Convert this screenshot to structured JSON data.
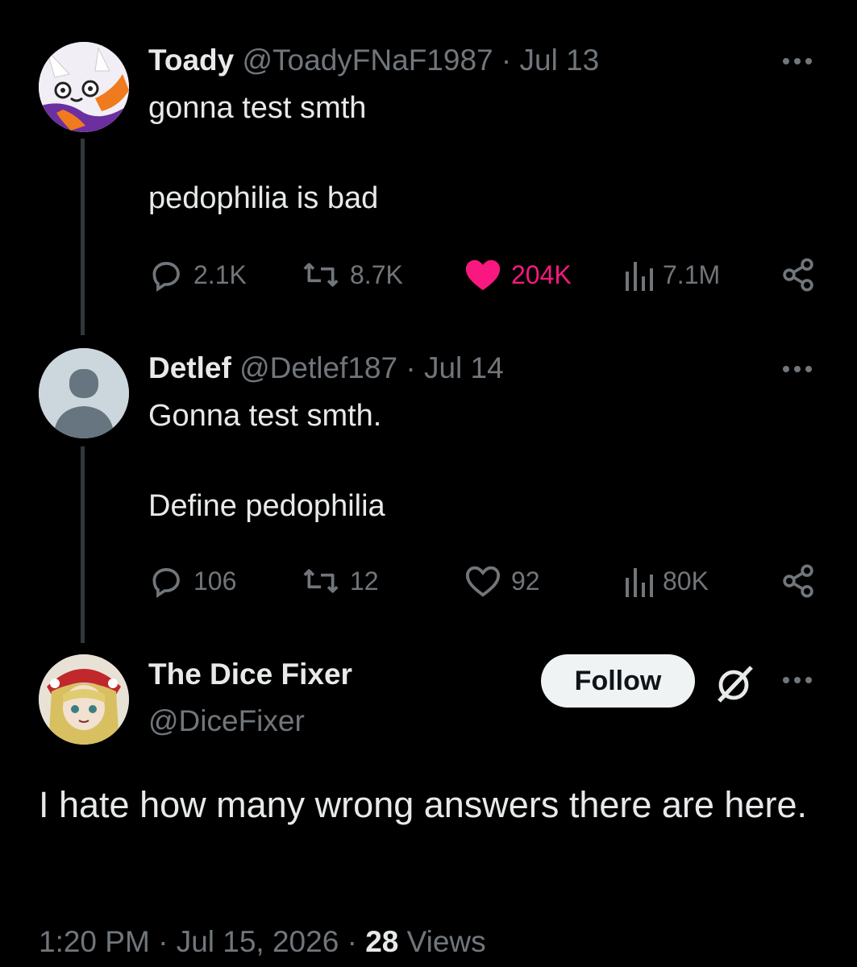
{
  "tweets": [
    {
      "name": "Toady",
      "handle": "@ToadyFNaF1987",
      "separator": "·",
      "date": "Jul 13",
      "line1": "gonna test smth",
      "line2": "pedophilia is bad",
      "replies": "2.1K",
      "reposts": "8.7K",
      "likes": "204K",
      "views": "7.1M",
      "liked": true
    },
    {
      "name": "Detlef",
      "handle": "@Detlef187",
      "separator": "·",
      "date": "Jul 14",
      "line1": "Gonna test smth.",
      "line2": "Define pedophilia",
      "replies": "106",
      "reposts": "12",
      "likes": "92",
      "views": "80K",
      "liked": false
    }
  ],
  "main": {
    "name": "The Dice Fixer",
    "handle": "@DiceFixer",
    "follow_label": "Follow",
    "text": "I hate how many wrong answers there are here.",
    "time": "1:20 PM",
    "separator": "·",
    "date": "Jul 15, 2026",
    "views_count": "28",
    "views_label": "Views"
  },
  "colors": {
    "background": "#000000",
    "text": "#e7e9ea",
    "secondary": "#71767b",
    "like_active": "#f91880",
    "thread_line": "#333639"
  },
  "icons": {
    "reply": "reply-icon",
    "repost": "repost-icon",
    "like": "heart-icon",
    "views": "views-icon",
    "share": "share-icon",
    "more": "more-icon",
    "grok": "grok-icon"
  }
}
